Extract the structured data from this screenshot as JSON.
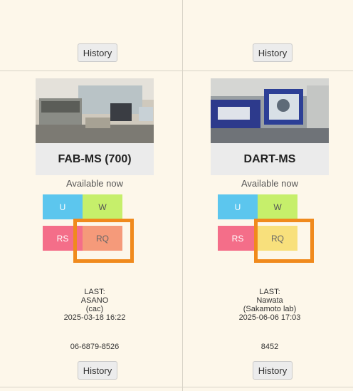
{
  "colors": {
    "background": "#fdf7ea",
    "tile_u": "#5cc6ee",
    "tile_w": "#c6ef6b",
    "tile_rs": "#f46e89",
    "tile_rq_fab": "#f59a7a",
    "tile_rq_dart": "#f8e07c",
    "highlight": "#f08a1d"
  },
  "instruments": [
    {
      "top_history_label": "History",
      "name": "FAB-MS (700)",
      "status": "Available now",
      "tiles": {
        "u": "U",
        "w": "W",
        "rs": "RS",
        "rq": "RQ"
      },
      "last_label": "LAST:",
      "last_user": "ASANO",
      "last_group": "(cac)",
      "last_time": "2025-03-18 16:22",
      "phone": "06-6879-8526",
      "bottom_history_label": "History"
    },
    {
      "top_history_label": "History",
      "name": "DART-MS",
      "status": "Available now",
      "tiles": {
        "u": "U",
        "w": "W",
        "rs": "RS",
        "rq": "RQ"
      },
      "last_label": "LAST:",
      "last_user": "Nawata",
      "last_group": "(Sakamoto lab)",
      "last_time": "2025-06-06 17:03",
      "phone": "8452",
      "bottom_history_label": "History"
    }
  ]
}
